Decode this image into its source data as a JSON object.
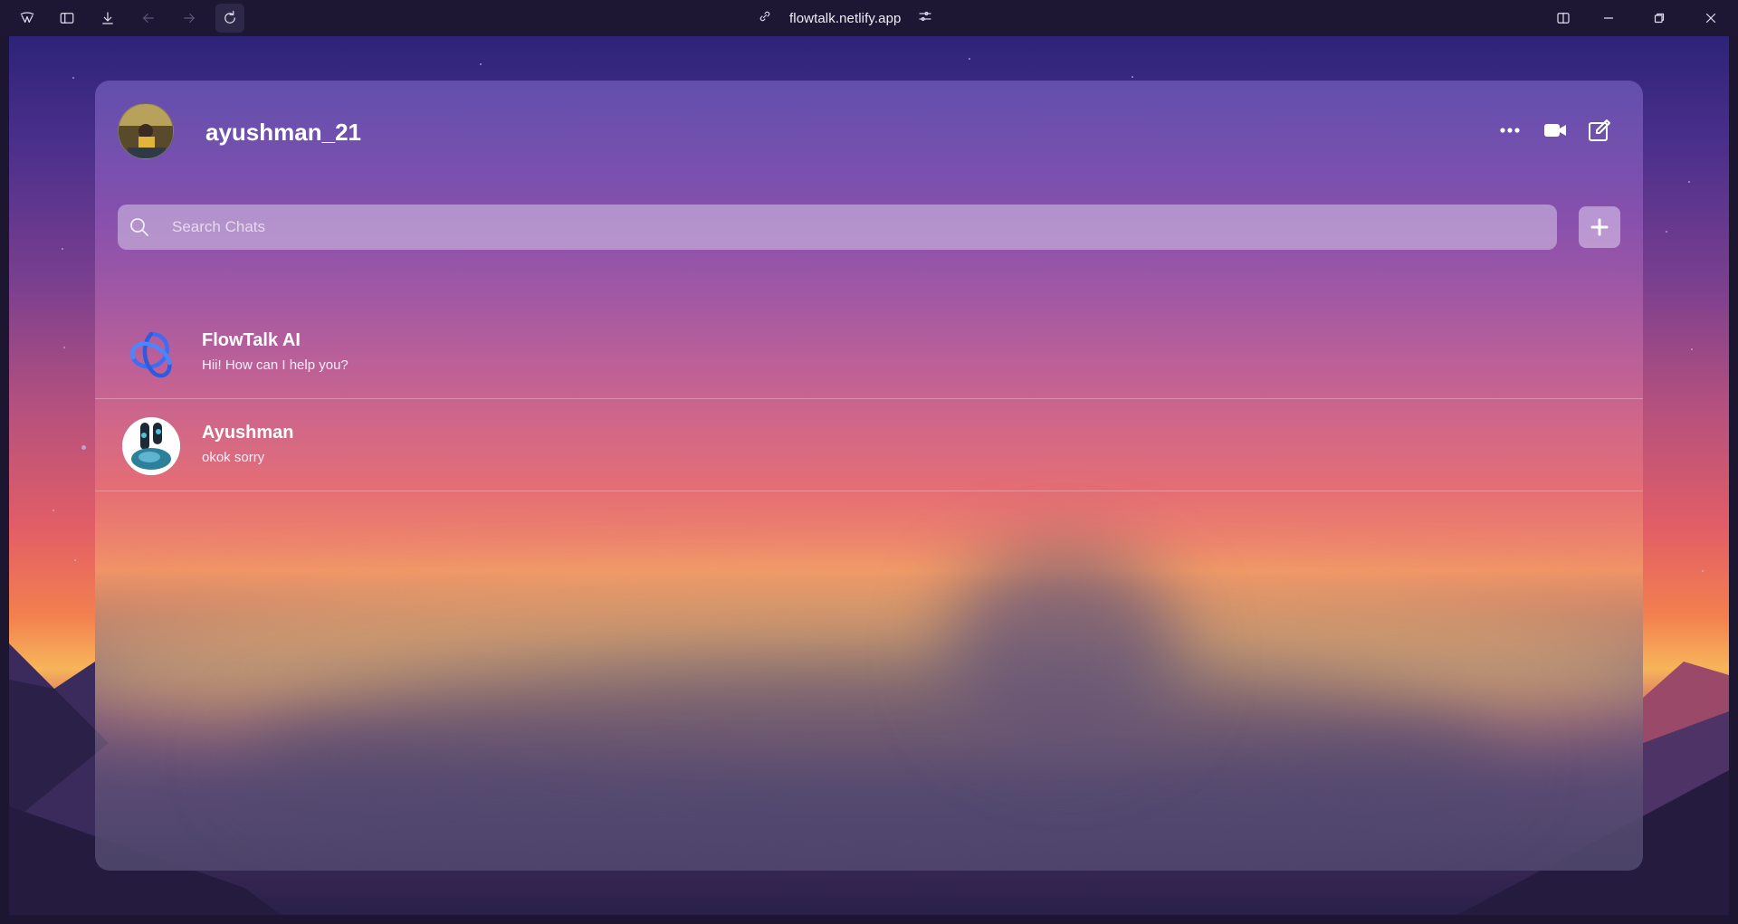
{
  "browser": {
    "url": "flowtalk.netlify.app"
  },
  "profile": {
    "username": "ayushman_21"
  },
  "search": {
    "placeholder": "Search Chats"
  },
  "chats": [
    {
      "name": "FlowTalk AI",
      "last_message": "Hii! How can I help you?",
      "avatar_icon": "flowtalk-logo-icon"
    },
    {
      "name": "Ayushman",
      "last_message": "okok sorry",
      "avatar_icon": "avatar"
    }
  ],
  "colors": {
    "accent_blue": "#3b6ef5",
    "panel_text": "#ffffff"
  }
}
